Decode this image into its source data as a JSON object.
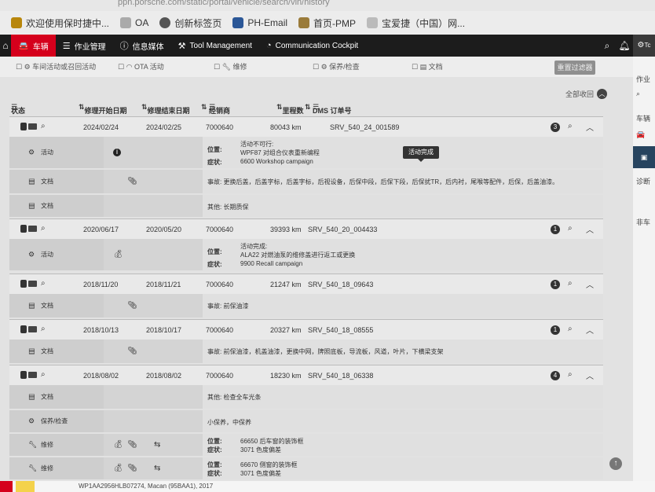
{
  "browser": {
    "url_fragment": "ppn.porsche.com/static/portal/vehicle/search/vin/history",
    "bookmarks": [
      "欢迎使用保时捷中...",
      "OA",
      "创新标签页",
      "PH-Email",
      "首页-PMP",
      "宝爱捷（中国）网..."
    ]
  },
  "topnav": {
    "items": [
      "车辆",
      "作业管理",
      "信息媒体",
      "Tool Management",
      "Communication Cockpit"
    ],
    "active_index": 0,
    "right_icons": [
      "search-icon",
      "bell-icon",
      "gear-icon"
    ],
    "user_short": "Tc"
  },
  "right_sidebar": {
    "labels": [
      "作业",
      "车辆",
      "诊断",
      "非车"
    ]
  },
  "filters": {
    "items": [
      "车间活动或召回活动",
      "OTA 活动",
      "维修",
      "保养/检查",
      "文档"
    ],
    "reset_label": "重置过滤器"
  },
  "list": {
    "collapse_all_label": "全部收回",
    "columns": [
      "状态",
      "修理开始日期",
      "修理结束日期",
      "经销商",
      "里程数",
      "DMS 订单号"
    ],
    "tooltip": "活动完成"
  },
  "records": [
    {
      "start": "2024/02/24",
      "end": "2024/02/25",
      "dealer": "7000640",
      "mileage": "80043 km",
      "order": "SRV_540_24_001589",
      "badge": "3",
      "subs": [
        {
          "type": "活动",
          "lines": [
            {
              "k": "位置:",
              "v": "活动不可行:"
            },
            {
              "k": "",
              "v": "WPF87 对组合仪表重新编程"
            },
            {
              "k": "症状:",
              "v": "6600 Workshop campaign"
            }
          ]
        },
        {
          "type": "文档",
          "lines": [
            {
              "k": "",
              "v": "事故: 更换后盖，后盖字标，后盖字标，后视设备，后保中段，后保下段，后保扰TR，后内衬，尾喉等配件，后保，后盖油漆。"
            }
          ]
        },
        {
          "type": "文档",
          "lines": [
            {
              "k": "",
              "v": "其他: 长期质保"
            }
          ]
        }
      ]
    },
    {
      "start": "2020/06/17",
      "end": "2020/05/20",
      "dealer": "7000640",
      "mileage": "39393 km",
      "order": "SRV_540_20_004433",
      "badge": "1",
      "subs": [
        {
          "type": "活动",
          "lines": [
            {
              "k": "位置:",
              "v": "活动完成:"
            },
            {
              "k": "",
              "v": "ALA22 对燃油泵的维修盖进行返工或更换"
            },
            {
              "k": "症状:",
              "v": "9900 Recall campaign"
            }
          ]
        }
      ]
    },
    {
      "start": "2018/11/20",
      "end": "2018/11/21",
      "dealer": "7000640",
      "mileage": "21247 km",
      "order": "SRV_540_18_09643",
      "badge": "1",
      "subs": [
        {
          "type": "文档",
          "lines": [
            {
              "k": "",
              "v": "事故: 前保油漆"
            }
          ]
        }
      ]
    },
    {
      "start": "2018/10/13",
      "end": "2018/10/17",
      "dealer": "7000640",
      "mileage": "20327 km",
      "order": "SRV_540_18_08555",
      "badge": "1",
      "subs": [
        {
          "type": "文档",
          "lines": [
            {
              "k": "",
              "v": "事故: 前保油漆，机盖油漆，更换中网，牌照底板，导流板，风道，叶片，下横梁支架"
            }
          ]
        }
      ]
    },
    {
      "start": "2018/08/02",
      "end": "2018/08/02",
      "dealer": "7000640",
      "mileage": "18230 km",
      "order": "SRV_540_18_06338",
      "badge": "4",
      "subs": [
        {
          "type": "文档",
          "lines": [
            {
              "k": "",
              "v": "其他: 检查全车光条"
            }
          ]
        },
        {
          "type": "保养/检查",
          "lines": [
            {
              "k": "",
              "v": "小保养，中保养"
            }
          ]
        },
        {
          "type": "维修",
          "lines": [
            {
              "k": "位置:",
              "v": "66650 后车窗的装饰框"
            },
            {
              "k": "症状:",
              "v": "3071 色度偏差"
            }
          ]
        },
        {
          "type": "维修",
          "lines": [
            {
              "k": "位置:",
              "v": "66670 侧窗的装饰框"
            },
            {
              "k": "症状:",
              "v": "3071 色度偏差"
            }
          ]
        }
      ]
    }
  ],
  "footer": {
    "vehicle": "WP1AA2956HLB07274, Macan (95BAA1), 2017"
  }
}
